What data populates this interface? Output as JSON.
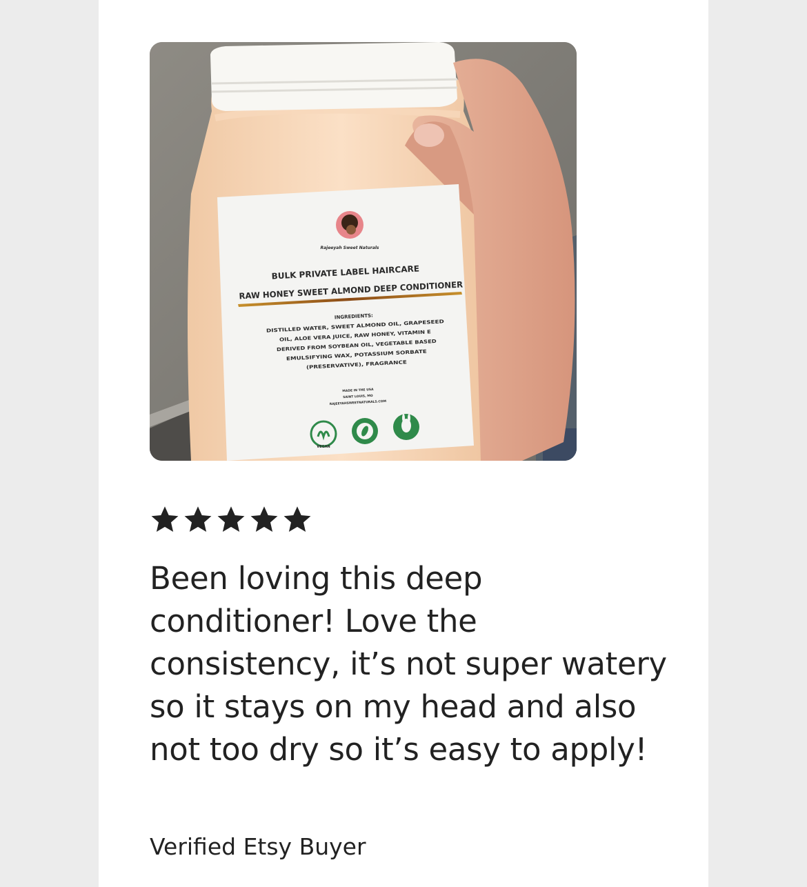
{
  "review": {
    "rating": 5,
    "rating_max": 5,
    "star_color": "#222222",
    "text": "Been loving this deep conditioner! Love the consistency, it’s not super watery so it stays on my head and also not too dry so it’s easy to apply!",
    "reviewer": "Verified Etsy Buyer"
  },
  "photo": {
    "brand": "Rajeeyah Sweet Naturals",
    "title_line1": "BULK PRIVATE LABEL HAIRCARE",
    "title_line2": "RAW HONEY SWEET ALMOND DEEP CONDITIONER",
    "ingredients_heading": "INGREDIENTS:",
    "ingredients_lines": [
      "DISTILLED WATER, SWEET ALMOND OIL, GRAPESEED",
      "OIL, ALOE VERA JUICE, RAW HONEY, VITAMIN E",
      "DERIVED FROM SOYBEAN OIL, VEGETABLE BASED",
      "EMULSIFYING WAX, POTASSIUM SORBATE",
      "(PRESERVATIVE), FRAGRANCE"
    ],
    "made_in": "MADE IN THE USA",
    "city": "SAINT LOUIS, MO",
    "website": "RAJEEYAHSWEETNATURALS.COM",
    "badges": [
      "VEGAN",
      "100% ORGANIC",
      "CRUELTY FREE"
    ]
  }
}
